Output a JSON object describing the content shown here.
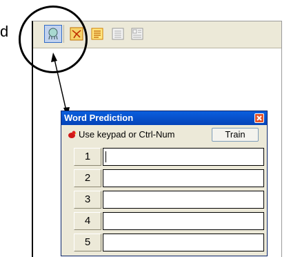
{
  "fragment_text": "d",
  "toolbar": {
    "buttons": [
      {
        "icon": "word-prediction-icon",
        "state": "pressed"
      },
      {
        "icon": "mindmap-icon"
      },
      {
        "icon": "notes-icon"
      },
      {
        "icon": "document-icon"
      },
      {
        "icon": "form-icon"
      }
    ]
  },
  "word_prediction": {
    "title": "Word Prediction",
    "hint": "Use keypad or Ctrl-Num",
    "train_label": "Train",
    "rows": [
      {
        "num": "1",
        "value": ""
      },
      {
        "num": "2",
        "value": ""
      },
      {
        "num": "3",
        "value": ""
      },
      {
        "num": "4",
        "value": ""
      },
      {
        "num": "5",
        "value": ""
      }
    ]
  },
  "colors": {
    "title_bar": "#0a5fde",
    "panel_bg": "#ece9d8",
    "close": "#e2532b"
  }
}
